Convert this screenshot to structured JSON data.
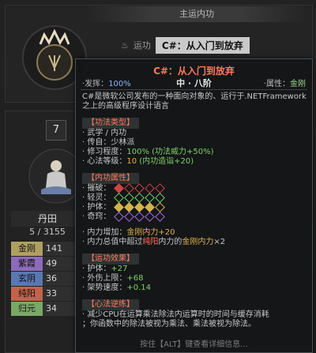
{
  "header": {
    "title": "主运内功"
  },
  "stamp": {
    "label": "运功",
    "skill_name": "C#：从入门到放弃"
  },
  "character": {
    "level": "7",
    "dantian_label": "丹田",
    "dantian_value": "5 / 3155",
    "stats": [
      {
        "name": "金刚",
        "value": "141",
        "color": "#b0a060"
      },
      {
        "name": "紫霞",
        "value": "49",
        "color": "#8d6bb8"
      },
      {
        "name": "玄阴",
        "value": "36",
        "color": "#5a78b0"
      },
      {
        "name": "纯阳",
        "value": "33",
        "color": "#c46248"
      },
      {
        "name": "归元",
        "value": "34",
        "color": "#7aa866"
      }
    ]
  },
  "tooltip": {
    "title": "C#：从入门到放弃",
    "subtitle": "中 · 八阶",
    "left_stat_label": "·发挥：",
    "left_stat_value": "100%",
    "right_stat_label": "·属性：",
    "right_stat_value": "金刚",
    "description": "C#是微软公司发布的一种面向对象的、运行于.NETFramework之上的高级程序设计语言",
    "sections": {
      "type_header": "【功法类型】",
      "type_lines": {
        "l1": "· 武学 / 内功",
        "l2": "· 传自：少林派",
        "l3_prefix": "· 修习程度：",
        "l3_value": "100%",
        "l3_suffix": " (功法威力+50%)",
        "l4_prefix": "· 心法等级：",
        "l4_value": "10",
        "l4_suffix": " (内功造诣+20)"
      },
      "attr_header": "【内功属性】",
      "attrs": {
        "a1": "· 摧破：",
        "a2": "· 轻灵：",
        "a3": "· 护体：",
        "a4": "· 奇窍："
      },
      "neili_line1_prefix": "· 内力增加：",
      "neili_line1_value": "金刚内力+20",
      "neili_line2_prefix": "· 内力总值中超过",
      "neili_line2_red": "纯阳",
      "neili_line2_mid": "内力的",
      "neili_line2_gold": "金刚内力",
      "neili_line2_suffix": "×2",
      "effect_header": "【运功效果】",
      "effects": {
        "e1_label": "· 护体：",
        "e1_value": "+27",
        "e2_label": "· 外伤上限：",
        "e2_value": "+68",
        "e3_label": "· 架势速度：",
        "e3_value": "+0.14"
      },
      "reverse_header": "【心法逆练】",
      "reverse_line1": "· 减少CPU在运算乘法除法内运算时的时间与缓存消耗",
      "reverse_line2": "；你函数中的除法被视为乘法、乘法被视为除法。"
    },
    "footer": "按住【ALT】键查看详细信息..."
  }
}
